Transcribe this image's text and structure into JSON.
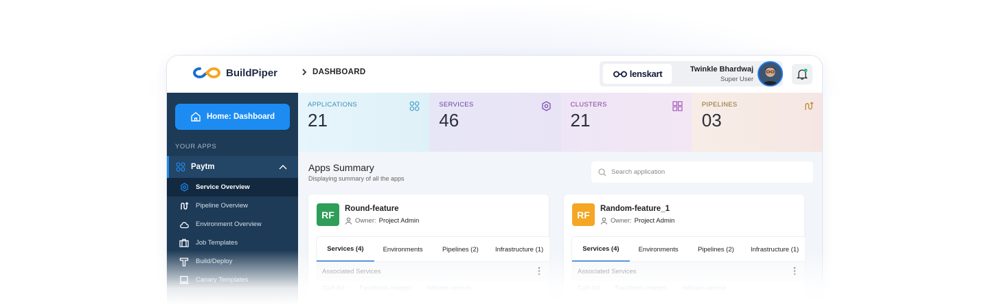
{
  "app": {
    "name": "BuildPiper"
  },
  "breadcrumb": {
    "current": "DASHBOARD"
  },
  "org": {
    "brand": "lenskart"
  },
  "user": {
    "name": "Twinkle Bhardwaj",
    "role": "Super User"
  },
  "sidebar": {
    "home_label": "Home: Dashboard",
    "section_label": "YOUR APPS",
    "app": {
      "name": "Paytm"
    },
    "items": [
      {
        "label": "Service Overview",
        "icon": "gear-icon"
      },
      {
        "label": "Pipeline Overview",
        "icon": "pipeline-icon"
      },
      {
        "label": "Environment Overview",
        "icon": "cloud-icon"
      },
      {
        "label": "Job Templates",
        "icon": "briefcase-icon"
      },
      {
        "label": "Build/Deploy",
        "icon": "hammer-icon"
      },
      {
        "label": "Canary Templates",
        "icon": "laptop-icon"
      }
    ]
  },
  "stats": [
    {
      "label": "APPLICATIONS",
      "value": "21",
      "color": "#3a8fb7",
      "icon": "apps-grid-icon",
      "bg": "#e3f4fa"
    },
    {
      "label": "SERVICES",
      "value": "46",
      "color": "#6b3fa0",
      "icon": "gear-icon",
      "bg": "#e8e6f6"
    },
    {
      "label": "CLUSTERS",
      "value": "21",
      "color": "#8a3a9e",
      "icon": "grid-icon",
      "bg": "#f1e6f6"
    },
    {
      "label": "PIPELINES",
      "value": "03",
      "color": "#8a6a2a",
      "icon": "pipeline-icon",
      "bg": "#f7ece6"
    }
  ],
  "summary": {
    "title": "Apps Summary",
    "subtitle": "Displaying summary of all the apps",
    "search_placeholder": "Search application"
  },
  "cards": [
    {
      "initials": "RF",
      "badge_color": "#2e9e58",
      "title": "Round-feature",
      "owner_label": "Owner:",
      "owner": "Project Admin",
      "tabs": [
        "Services (4)",
        "Environments",
        "Pipelines (2)",
        "Infrastructure (1)"
      ],
      "section_label": "Associated Services",
      "services": [
        "Cart-list",
        "Facebook-images",
        "indexer-service"
      ]
    },
    {
      "initials": "RF",
      "badge_color": "#f5a623",
      "title": "Random-feature_1",
      "owner_label": "Owner:",
      "owner": "Project Admin",
      "tabs": [
        "Services (4)",
        "Environments",
        "Pipelines (2)",
        "Infrastructure (1)"
      ],
      "section_label": "Associated Services",
      "services": [
        "Cart-list",
        "Facebook-images",
        "indexer-service"
      ]
    }
  ]
}
